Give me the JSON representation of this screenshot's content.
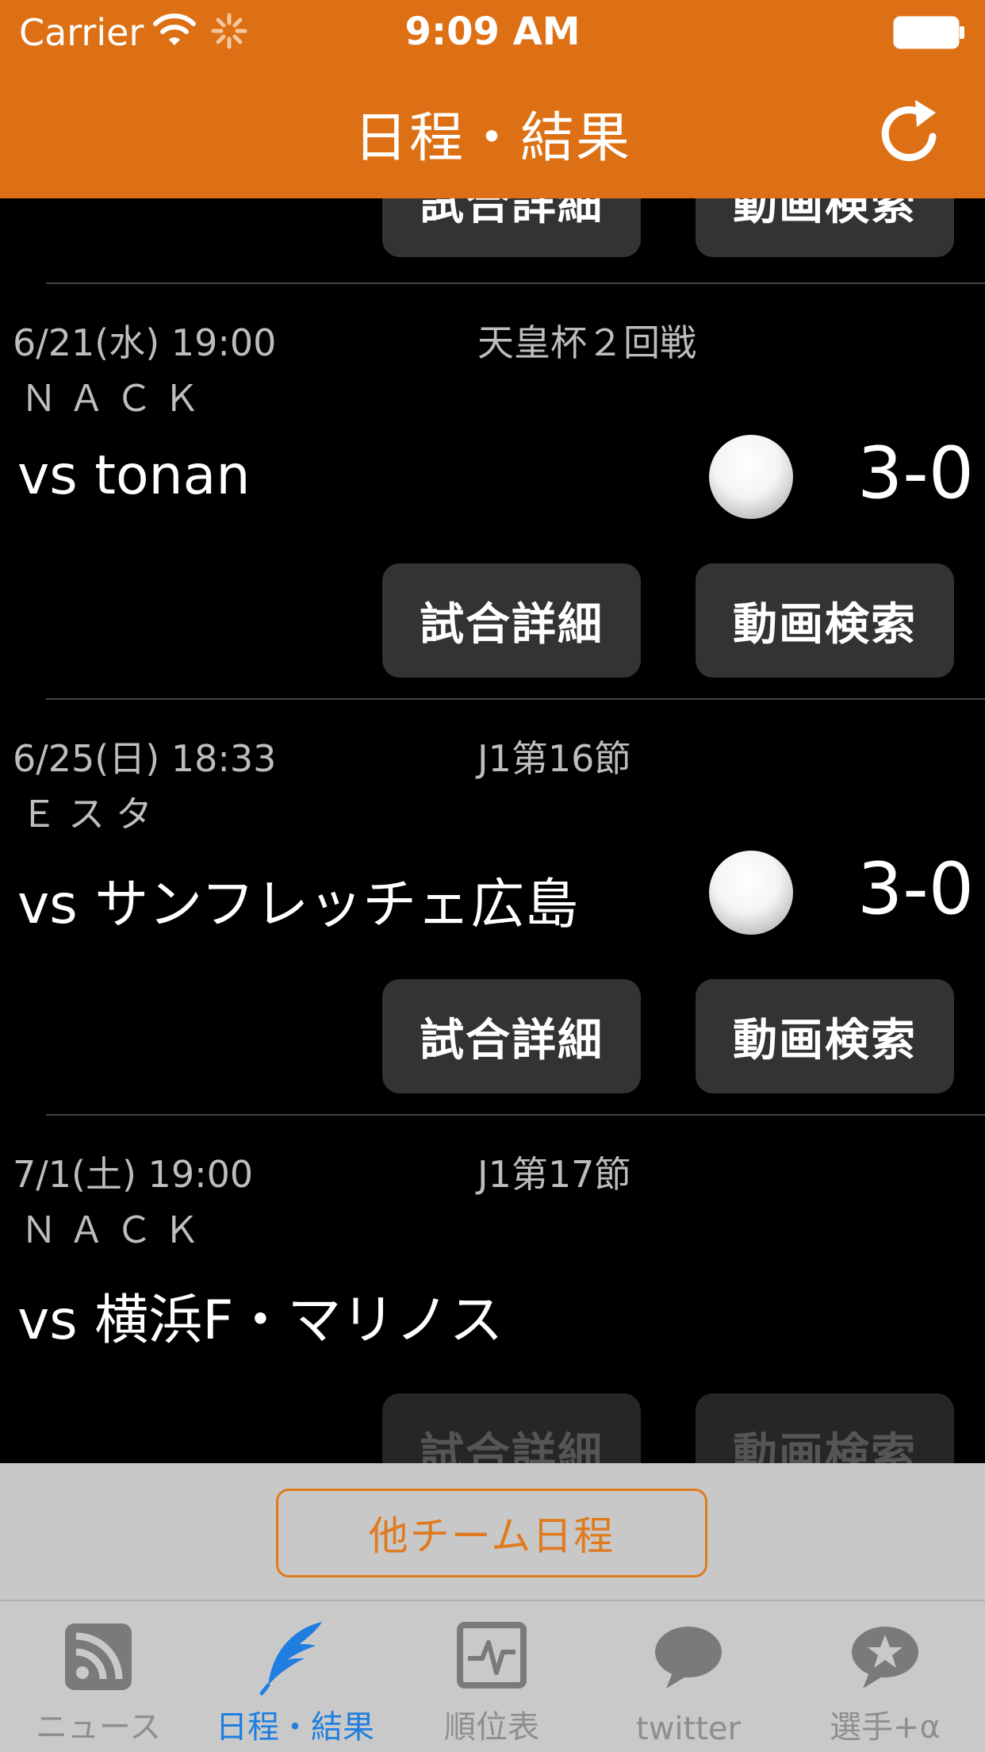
{
  "status_bar": {
    "carrier": "Carrier",
    "time": "9:09 AM"
  },
  "nav": {
    "title": "日程・結果",
    "refresh_icon": "refresh-icon"
  },
  "buttons": {
    "detail": "試合詳細",
    "video": "動画検索"
  },
  "matches": [
    {
      "date": "6/21(水) 19:00",
      "competition": "天皇杯２回戦",
      "venue": "ＮＡＣＫ",
      "opponent": "vs tonan",
      "result_icon": "win-ball-icon",
      "score": "3-0"
    },
    {
      "date": "6/25(日) 18:33",
      "competition": "J1第16節",
      "venue": "Ｅスタ",
      "opponent": "vs サンフレッチェ広島",
      "result_icon": "win-ball-icon",
      "score": "3-0"
    },
    {
      "date": "7/1(土) 19:00",
      "competition": "J1第17節",
      "venue": "ＮＡＣＫ",
      "opponent": "vs 横浜F・マリノス",
      "score": ""
    }
  ],
  "other_team_button": "他チーム日程",
  "tabs": [
    {
      "label": "ニュース",
      "icon": "rss-icon",
      "active": false
    },
    {
      "label": "日程・結果",
      "icon": "feather-icon",
      "active": true
    },
    {
      "label": "順位表",
      "icon": "chart-icon",
      "active": false
    },
    {
      "label": "twitter",
      "icon": "speech-bubble-icon",
      "active": false
    },
    {
      "label": "選手+α",
      "icon": "star-bubble-icon",
      "active": false
    }
  ],
  "colors": {
    "accent": "#dd7014",
    "tab_active": "#1f7ee0",
    "button_bg": "#333333"
  }
}
